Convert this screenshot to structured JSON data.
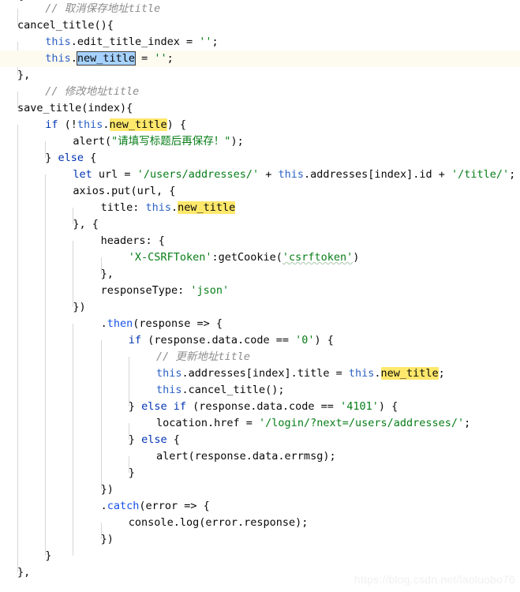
{
  "editor": {
    "language": "javascript",
    "theme": "light",
    "colors": {
      "background": "#ffffff",
      "text": "#080808",
      "keyword": "#0033b3",
      "string": "#067d17",
      "comment": "#8c8c8c",
      "property": "#2b61c5",
      "function": "#1750eb",
      "number": "#1750eb",
      "search_highlight": "#ffe86b",
      "selection": "#a6d2ff",
      "active_line": "#fdfaf0",
      "indent_guide": "#d6d6d6"
    },
    "search_term": "new_title",
    "lines": [
      {
        "indent": 0,
        "active": false,
        "clipped": true,
        "tokens": [
          {
            "t": "},",
            "c": "plain"
          }
        ]
      },
      {
        "indent": 1,
        "active": false,
        "tokens": [
          {
            "t": "// ",
            "c": "cmt"
          },
          {
            "t": "取消保存地址title",
            "c": "cmt"
          }
        ]
      },
      {
        "indent": 0,
        "active": false,
        "tokens": [
          {
            "t": "cancel_title(){",
            "c": "plain"
          }
        ]
      },
      {
        "indent": 1,
        "active": false,
        "tokens": [
          {
            "t": "this",
            "c": "this"
          },
          {
            "t": ".edit_title_index = ",
            "c": "plain"
          },
          {
            "t": "''",
            "c": "str"
          },
          {
            "t": ";",
            "c": "plain"
          }
        ]
      },
      {
        "indent": 1,
        "active": true,
        "tokens": [
          {
            "t": "this",
            "c": "this"
          },
          {
            "t": ".",
            "c": "plain"
          },
          {
            "t": "new_title",
            "c": "plain",
            "mark": "select"
          },
          {
            "t": " = ",
            "c": "plain"
          },
          {
            "t": "''",
            "c": "str"
          },
          {
            "t": ";",
            "c": "plain"
          }
        ]
      },
      {
        "indent": 0,
        "active": false,
        "tokens": [
          {
            "t": "},",
            "c": "plain"
          }
        ]
      },
      {
        "indent": 1,
        "active": false,
        "tokens": [
          {
            "t": "// ",
            "c": "cmt"
          },
          {
            "t": "修改地址title",
            "c": "cmt"
          }
        ]
      },
      {
        "indent": 0,
        "active": false,
        "tokens": [
          {
            "t": "save_title(index){",
            "c": "plain"
          }
        ]
      },
      {
        "indent": 1,
        "active": false,
        "tokens": [
          {
            "t": "if",
            "c": "kw"
          },
          {
            "t": " (!",
            "c": "plain"
          },
          {
            "t": "this",
            "c": "this"
          },
          {
            "t": ".",
            "c": "plain"
          },
          {
            "t": "new_title",
            "c": "plain",
            "mark": "yellow"
          },
          {
            "t": ") {",
            "c": "plain"
          }
        ]
      },
      {
        "indent": 2,
        "active": false,
        "tokens": [
          {
            "t": "alert(",
            "c": "plain"
          },
          {
            "t": "\"请填写标题后再保存！\"",
            "c": "str"
          },
          {
            "t": ");",
            "c": "plain"
          }
        ]
      },
      {
        "indent": 1,
        "active": false,
        "tokens": [
          {
            "t": "} ",
            "c": "plain"
          },
          {
            "t": "else",
            "c": "kw"
          },
          {
            "t": " {",
            "c": "plain"
          }
        ]
      },
      {
        "indent": 2,
        "active": false,
        "tokens": [
          {
            "t": "let",
            "c": "kw"
          },
          {
            "t": " url = ",
            "c": "plain"
          },
          {
            "t": "'/users/addresses/'",
            "c": "str"
          },
          {
            "t": " + ",
            "c": "plain"
          },
          {
            "t": "this",
            "c": "this"
          },
          {
            "t": ".addresses[index].id + ",
            "c": "plain"
          },
          {
            "t": "'/title/'",
            "c": "str"
          },
          {
            "t": ";",
            "c": "plain"
          }
        ]
      },
      {
        "indent": 2,
        "active": false,
        "tokens": [
          {
            "t": "axios.put(url, {",
            "c": "plain"
          }
        ]
      },
      {
        "indent": 3,
        "active": false,
        "tokens": [
          {
            "t": "title: ",
            "c": "plain"
          },
          {
            "t": "this",
            "c": "this"
          },
          {
            "t": ".",
            "c": "plain"
          },
          {
            "t": "new_title",
            "c": "plain",
            "mark": "yellow"
          }
        ]
      },
      {
        "indent": 2,
        "active": false,
        "tokens": [
          {
            "t": "}, {",
            "c": "plain"
          }
        ]
      },
      {
        "indent": 3,
        "active": false,
        "tokens": [
          {
            "t": "headers: {",
            "c": "plain"
          }
        ]
      },
      {
        "indent": 4,
        "active": false,
        "tokens": [
          {
            "t": "'X-CSRFToken'",
            "c": "str"
          },
          {
            "t": ":getCookie(",
            "c": "plain"
          },
          {
            "t": "'csrftoken'",
            "c": "str",
            "mark": "squiggle"
          },
          {
            "t": ")",
            "c": "plain"
          }
        ]
      },
      {
        "indent": 3,
        "active": false,
        "tokens": [
          {
            "t": "},",
            "c": "plain"
          }
        ]
      },
      {
        "indent": 3,
        "active": false,
        "tokens": [
          {
            "t": "responseType: ",
            "c": "plain"
          },
          {
            "t": "'json'",
            "c": "str"
          }
        ]
      },
      {
        "indent": 2,
        "active": false,
        "tokens": [
          {
            "t": "})",
            "c": "plain"
          }
        ]
      },
      {
        "indent": 3,
        "active": false,
        "tokens": [
          {
            "t": ".",
            "c": "plain"
          },
          {
            "t": "then",
            "c": "fn"
          },
          {
            "t": "(response => {",
            "c": "plain"
          }
        ]
      },
      {
        "indent": 4,
        "active": false,
        "tokens": [
          {
            "t": "if",
            "c": "kw"
          },
          {
            "t": " (response.data.code == ",
            "c": "plain"
          },
          {
            "t": "'0'",
            "c": "str"
          },
          {
            "t": ") {",
            "c": "plain"
          }
        ]
      },
      {
        "indent": 5,
        "active": false,
        "tokens": [
          {
            "t": "// ",
            "c": "cmt"
          },
          {
            "t": "更新地址title",
            "c": "cmt"
          }
        ]
      },
      {
        "indent": 5,
        "active": false,
        "tokens": [
          {
            "t": "this",
            "c": "this"
          },
          {
            "t": ".addresses[index].title = ",
            "c": "plain"
          },
          {
            "t": "this",
            "c": "this"
          },
          {
            "t": ".",
            "c": "plain"
          },
          {
            "t": "new_title",
            "c": "plain",
            "mark": "yellow"
          },
          {
            "t": ";",
            "c": "plain"
          }
        ]
      },
      {
        "indent": 5,
        "active": false,
        "tokens": [
          {
            "t": "this",
            "c": "this"
          },
          {
            "t": ".cancel_title();",
            "c": "plain"
          }
        ]
      },
      {
        "indent": 4,
        "active": false,
        "tokens": [
          {
            "t": "} ",
            "c": "plain"
          },
          {
            "t": "else",
            "c": "kw"
          },
          {
            "t": " ",
            "c": "plain"
          },
          {
            "t": "if",
            "c": "kw"
          },
          {
            "t": " (response.data.code == ",
            "c": "plain"
          },
          {
            "t": "'4101'",
            "c": "str"
          },
          {
            "t": ") {",
            "c": "plain"
          }
        ]
      },
      {
        "indent": 5,
        "active": false,
        "tokens": [
          {
            "t": "location.href = ",
            "c": "plain"
          },
          {
            "t": "'/login/?next=/users/addresses/'",
            "c": "str"
          },
          {
            "t": ";",
            "c": "plain"
          }
        ]
      },
      {
        "indent": 4,
        "active": false,
        "tokens": [
          {
            "t": "} ",
            "c": "plain"
          },
          {
            "t": "else",
            "c": "kw"
          },
          {
            "t": " {",
            "c": "plain"
          }
        ]
      },
      {
        "indent": 5,
        "active": false,
        "tokens": [
          {
            "t": "alert(response.data.errmsg);",
            "c": "plain"
          }
        ]
      },
      {
        "indent": 4,
        "active": false,
        "tokens": [
          {
            "t": "}",
            "c": "plain"
          }
        ]
      },
      {
        "indent": 3,
        "active": false,
        "tokens": [
          {
            "t": "})",
            "c": "plain"
          }
        ]
      },
      {
        "indent": 3,
        "active": false,
        "tokens": [
          {
            "t": ".",
            "c": "plain"
          },
          {
            "t": "catch",
            "c": "fn"
          },
          {
            "t": "(error => {",
            "c": "plain"
          }
        ]
      },
      {
        "indent": 4,
        "active": false,
        "tokens": [
          {
            "t": "console.log(error.response);",
            "c": "plain"
          }
        ]
      },
      {
        "indent": 3,
        "active": false,
        "tokens": [
          {
            "t": "})",
            "c": "plain"
          }
        ]
      },
      {
        "indent": 1,
        "active": false,
        "tokens": [
          {
            "t": "}",
            "c": "plain"
          }
        ]
      },
      {
        "indent": 0,
        "active": false,
        "tokens": [
          {
            "t": "},",
            "c": "plain"
          }
        ]
      }
    ],
    "indent_guides_x": [
      22,
      57,
      92,
      127,
      162,
      197
    ]
  },
  "watermark": {
    "text": "https://blog.csdn.net/laoluobo76"
  }
}
